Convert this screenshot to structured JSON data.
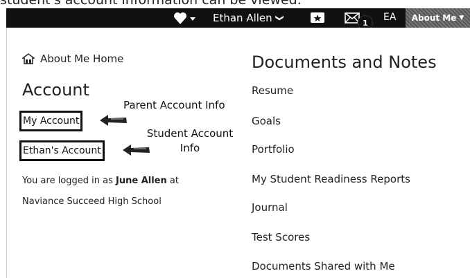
{
  "caption": {
    "text": "student's account information can be viewed."
  },
  "topbar": {
    "user_name": "Ethan Allen",
    "user_chevron": "❯",
    "notification_count": "1",
    "initials": "EA",
    "about_me_label": "About Me",
    "about_me_caret": "▼"
  },
  "icons": [
    "heart-icon",
    "badge-icon",
    "mail-icon",
    "home-icon",
    "chevron-down-icon"
  ],
  "menu": {
    "home_label": "About Me Home",
    "account_heading": "Account",
    "my_account": "My Account",
    "ethans_account": "Ethan's Account",
    "logged_prefix": "You are logged in as ",
    "logged_user": "June Allen",
    "logged_suffix": " at",
    "logged_school": "Naviance Succeed High School"
  },
  "annotations": {
    "parent": "Parent Account Info",
    "student_line1": "Student Account",
    "student_line2": "Info"
  },
  "documents": {
    "heading": "Documents and Notes",
    "items": [
      "Resume",
      "Goals",
      "Portfolio",
      "My Student Readiness Reports",
      "Journal",
      "Test Scores",
      "Documents Shared with Me"
    ]
  },
  "colors": {
    "topbar": "#111111",
    "text": "#222222",
    "box_border": "#111111"
  }
}
